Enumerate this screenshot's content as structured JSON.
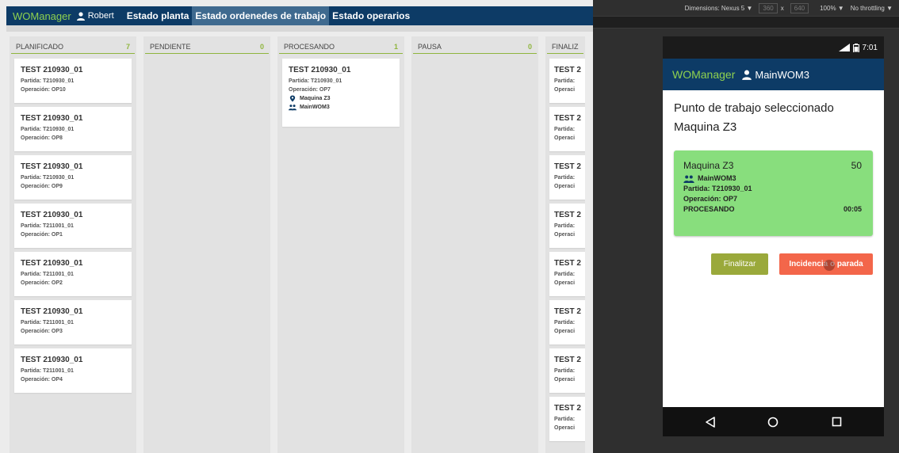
{
  "app": {
    "brand": "WOManager",
    "user": "Robert",
    "tabs": [
      {
        "label": "Estado planta"
      },
      {
        "label": "Estado ordenedes de trabajo"
      },
      {
        "label": "Estado operarios"
      }
    ]
  },
  "columns": [
    {
      "title": "PLANIFICADO",
      "count": "7",
      "cards": [
        {
          "title": "TEST 210930_01",
          "partida": "Partida: T210930_01",
          "operacion": "Operación: OP10"
        },
        {
          "title": "TEST 210930_01",
          "partida": "Partida: T210930_01",
          "operacion": "Operación: OP8"
        },
        {
          "title": "TEST 210930_01",
          "partida": "Partida: T210930_01",
          "operacion": "Operación: OP9"
        },
        {
          "title": "TEST 210930_01",
          "partida": "Partida: T211001_01",
          "operacion": "Operación: OP1"
        },
        {
          "title": "TEST 210930_01",
          "partida": "Partida: T211001_01",
          "operacion": "Operación: OP2"
        },
        {
          "title": "TEST 210930_01",
          "partida": "Partida: T211001_01",
          "operacion": "Operación: OP3"
        },
        {
          "title": "TEST 210930_01",
          "partida": "Partida: T211001_01",
          "operacion": "Operación: OP4"
        }
      ]
    },
    {
      "title": "PENDIENTE",
      "count": "0",
      "cards": []
    },
    {
      "title": "PROCESANDO",
      "count": "1",
      "cards": [
        {
          "title": "TEST 210930_01",
          "partida": "Partida: T210930_01",
          "operacion": "Operación: OP7",
          "machine": "Maquina Z3",
          "operator": "MainWOM3"
        }
      ]
    },
    {
      "title": "PAUSA",
      "count": "0",
      "cards": []
    },
    {
      "title": "FINALIZ",
      "cards": [
        {
          "title": "TEST 2",
          "partida": "Partida:",
          "operacion": "Operaci"
        },
        {
          "title": "TEST 2",
          "partida": "Partida:",
          "operacion": "Operaci"
        },
        {
          "title": "TEST 2",
          "partida": "Partida:",
          "operacion": "Operaci"
        },
        {
          "title": "TEST 2",
          "partida": "Partida:",
          "operacion": "Operaci"
        },
        {
          "title": "TEST 2",
          "partida": "Partida:",
          "operacion": "Operaci"
        },
        {
          "title": "TEST 2",
          "partida": "Partida:",
          "operacion": "Operaci"
        },
        {
          "title": "TEST 2",
          "partida": "Partida:",
          "operacion": "Operaci"
        },
        {
          "title": "TEST 2",
          "partida": "Partida:",
          "operacion": "Operaci"
        }
      ]
    }
  ],
  "devtools": {
    "dimensions": "Dimensions: Nexus 5 ▼",
    "width": "360",
    "x": "x",
    "height": "640",
    "zoom": "100% ▼",
    "throttle": "No throttling ▼"
  },
  "phone": {
    "time": "7:01",
    "brand": "WOManager",
    "user": "MainWOM3",
    "title": "Punto de trabajo seleccionado",
    "machine_heading": "Maquina Z3",
    "card": {
      "machine": "Maquina Z3",
      "number": "50",
      "operator": "MainWOM3",
      "partida": "Partida: T210930_01",
      "operacion": "Operación: OP7",
      "status": "PROCESANDO",
      "time": "00:05"
    },
    "btn_finalize": "Finalitzar",
    "btn_incident": "Incidencia o parada"
  },
  "colors": {
    "topbar": "#0d3b66",
    "brand": "#8fd14f",
    "accent_line": "#8fb53d",
    "card_green": "#88de7d",
    "btn_finalize": "#9aa93b",
    "btn_incident": "#f3664a"
  },
  "icons": {
    "user": "person-icon",
    "group": "people-icon",
    "location": "map-pin-icon",
    "nav": [
      "back-triangle-icon",
      "home-circle-icon",
      "recent-square-icon"
    ]
  }
}
